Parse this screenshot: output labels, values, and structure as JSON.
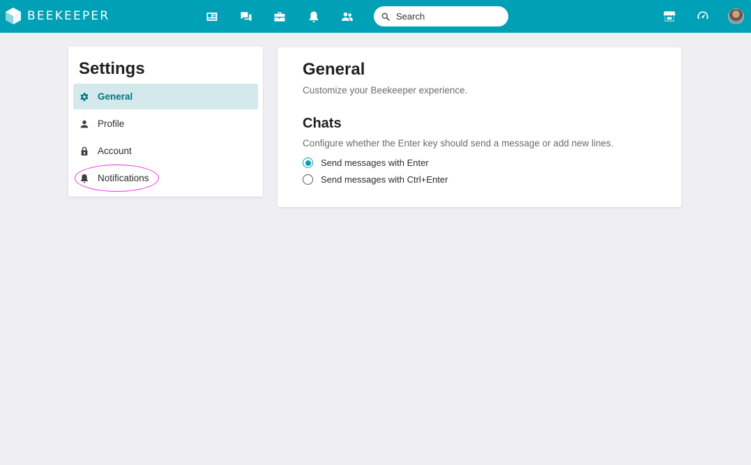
{
  "colors": {
    "accent": "#00a0b6",
    "active_bg": "#d4e9ec",
    "active_text": "#007583",
    "annotation": "#ee2dea"
  },
  "header": {
    "brand": "BEEKEEPER",
    "nav_icons": [
      "news-feed-icon",
      "chats-icon",
      "toolbox-icon",
      "notifications-bell-icon",
      "people-icon"
    ],
    "search": {
      "placeholder": "Search",
      "value": ""
    },
    "right_icons": [
      "store-icon",
      "dashboard-speedometer-icon",
      "user-avatar"
    ]
  },
  "sidebar": {
    "title": "Settings",
    "items": [
      {
        "label": "General",
        "icon": "gear-icon",
        "active": true
      },
      {
        "label": "Profile",
        "icon": "person-icon",
        "active": false
      },
      {
        "label": "Account",
        "icon": "lock-icon",
        "active": false
      },
      {
        "label": "Notifications",
        "icon": "bell-icon",
        "active": false
      }
    ]
  },
  "main": {
    "title": "General",
    "subtitle": "Customize your Beekeeper experience.",
    "chats": {
      "title": "Chats",
      "description": "Configure whether the Enter key should send a message or add new lines.",
      "options": [
        {
          "label": "Send messages with Enter",
          "checked": true
        },
        {
          "label": "Send messages with Ctrl+Enter",
          "checked": false
        }
      ]
    }
  }
}
